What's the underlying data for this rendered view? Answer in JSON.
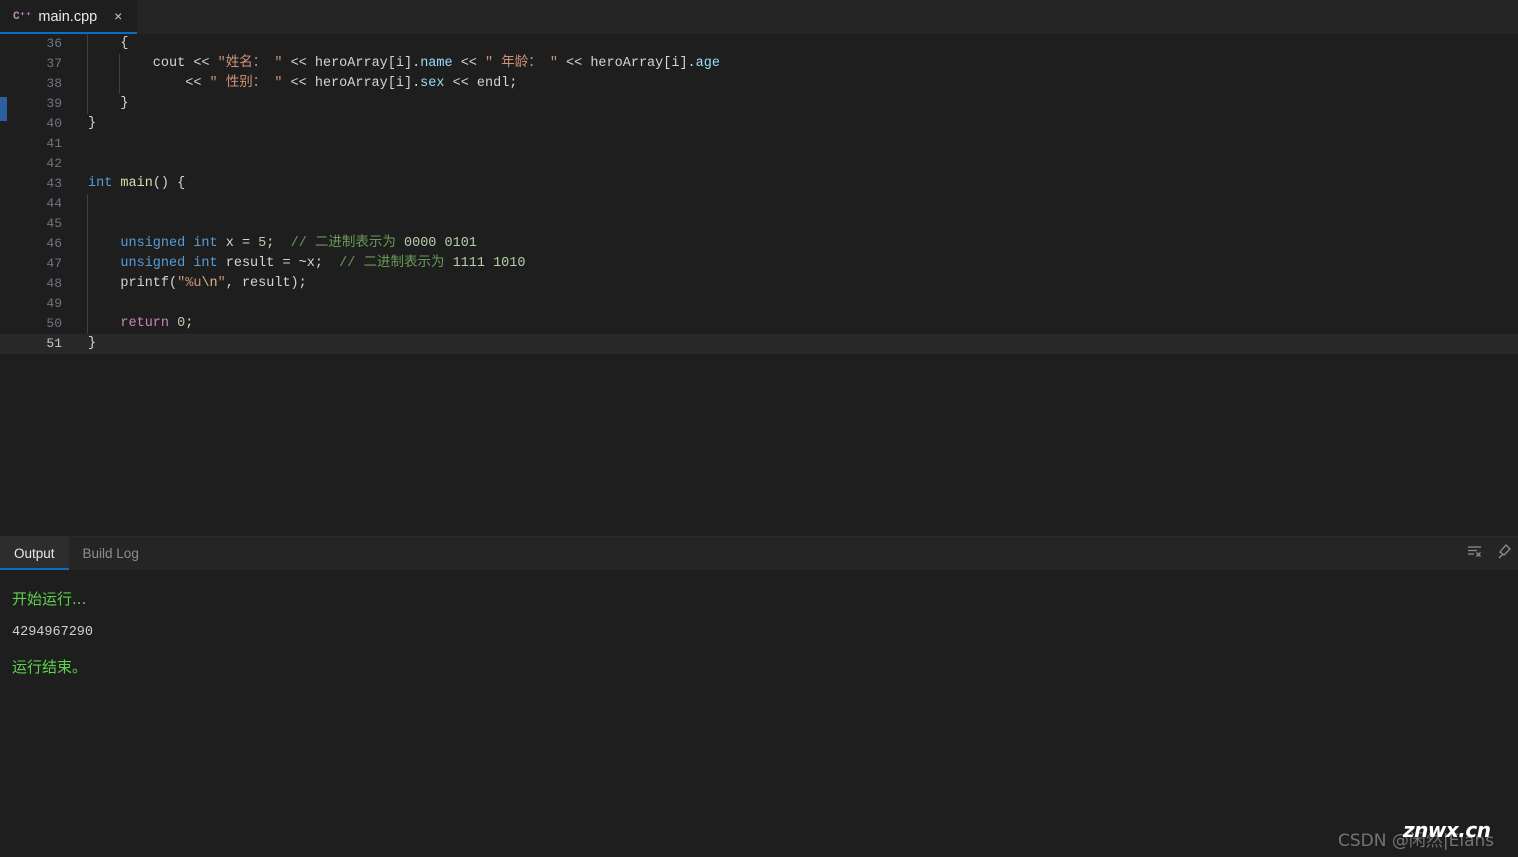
{
  "window": {
    "title": "main.cpp",
    "theme_background": "#1e1e1e",
    "accent_color": "#0a6cc4"
  },
  "tabbar": {
    "tabs": [
      {
        "label": "main.cpp",
        "icon": "cpp-file-icon",
        "icon_glyph": "C⁺⁺",
        "close_glyph": "×",
        "active": true
      }
    ]
  },
  "editor": {
    "language": "cpp",
    "first_visible_line": 36,
    "current_line": 51,
    "lines": [
      {
        "n": "36",
        "indent": 1,
        "tokens": [
          {
            "t": "    ",
            "c": "pl"
          },
          {
            "t": "{",
            "c": "pl"
          }
        ]
      },
      {
        "n": "37",
        "indent": 2,
        "tokens": [
          {
            "t": "        cout ",
            "c": "pl"
          },
          {
            "t": "<<",
            "c": "op"
          },
          {
            "t": " ",
            "c": "pl"
          },
          {
            "t": "\"姓名： \"",
            "c": "str"
          },
          {
            "t": " ",
            "c": "pl"
          },
          {
            "t": "<<",
            "c": "op"
          },
          {
            "t": " heroArray[i].",
            "c": "pl"
          },
          {
            "t": "name",
            "c": "var"
          },
          {
            "t": " ",
            "c": "pl"
          },
          {
            "t": "<<",
            "c": "op"
          },
          {
            "t": " ",
            "c": "pl"
          },
          {
            "t": "\" 年龄： \"",
            "c": "str"
          },
          {
            "t": " ",
            "c": "pl"
          },
          {
            "t": "<<",
            "c": "op"
          },
          {
            "t": " heroArray[i].",
            "c": "pl"
          },
          {
            "t": "age",
            "c": "var"
          }
        ]
      },
      {
        "n": "38",
        "indent": 2,
        "tokens": [
          {
            "t": "            ",
            "c": "pl"
          },
          {
            "t": "<<",
            "c": "op"
          },
          {
            "t": " ",
            "c": "pl"
          },
          {
            "t": "\" 性别： \"",
            "c": "str"
          },
          {
            "t": " ",
            "c": "pl"
          },
          {
            "t": "<<",
            "c": "op"
          },
          {
            "t": " heroArray[i].",
            "c": "pl"
          },
          {
            "t": "sex",
            "c": "var"
          },
          {
            "t": " ",
            "c": "pl"
          },
          {
            "t": "<<",
            "c": "op"
          },
          {
            "t": " endl;",
            "c": "pl"
          }
        ]
      },
      {
        "n": "39",
        "indent": 1,
        "tokens": [
          {
            "t": "    }",
            "c": "pl"
          }
        ]
      },
      {
        "n": "40",
        "indent": 0,
        "tokens": [
          {
            "t": "}",
            "c": "pl"
          }
        ]
      },
      {
        "n": "41",
        "indent": 0,
        "tokens": []
      },
      {
        "n": "42",
        "indent": 0,
        "tokens": []
      },
      {
        "n": "43",
        "indent": 0,
        "tokens": [
          {
            "t": "int",
            "c": "kw"
          },
          {
            "t": " ",
            "c": "pl"
          },
          {
            "t": "main",
            "c": "fn"
          },
          {
            "t": "() {",
            "c": "pl"
          }
        ]
      },
      {
        "n": "44",
        "indent": 1,
        "tokens": []
      },
      {
        "n": "45",
        "indent": 1,
        "tokens": []
      },
      {
        "n": "46",
        "indent": 1,
        "tokens": [
          {
            "t": "    ",
            "c": "pl"
          },
          {
            "t": "unsigned",
            "c": "kw"
          },
          {
            "t": " ",
            "c": "pl"
          },
          {
            "t": "int",
            "c": "kw"
          },
          {
            "t": " x ",
            "c": "pl"
          },
          {
            "t": "=",
            "c": "op"
          },
          {
            "t": " ",
            "c": "pl"
          },
          {
            "t": "5",
            "c": "num"
          },
          {
            "t": ";  ",
            "c": "pl"
          },
          {
            "t": "// 二进制表示为 ",
            "c": "cmt"
          },
          {
            "t": "0000 0101",
            "c": "num"
          }
        ]
      },
      {
        "n": "47",
        "indent": 1,
        "tokens": [
          {
            "t": "    ",
            "c": "pl"
          },
          {
            "t": "unsigned",
            "c": "kw"
          },
          {
            "t": " ",
            "c": "pl"
          },
          {
            "t": "int",
            "c": "kw"
          },
          {
            "t": " result ",
            "c": "pl"
          },
          {
            "t": "=",
            "c": "op"
          },
          {
            "t": " ~x;  ",
            "c": "pl"
          },
          {
            "t": "// 二进制表示为 ",
            "c": "cmt"
          },
          {
            "t": "1111 1010",
            "c": "num"
          }
        ]
      },
      {
        "n": "48",
        "indent": 1,
        "tokens": [
          {
            "t": "    printf(",
            "c": "pl"
          },
          {
            "t": "\"%u",
            "c": "str"
          },
          {
            "t": "\\n",
            "c": "esc"
          },
          {
            "t": "\"",
            "c": "str"
          },
          {
            "t": ", result);",
            "c": "pl"
          }
        ]
      },
      {
        "n": "49",
        "indent": 1,
        "tokens": []
      },
      {
        "n": "50",
        "indent": 1,
        "tokens": [
          {
            "t": "    ",
            "c": "pl"
          },
          {
            "t": "return",
            "c": "kw2"
          },
          {
            "t": " ",
            "c": "pl"
          },
          {
            "t": "0",
            "c": "num"
          },
          {
            "t": ";",
            "c": "pl"
          }
        ]
      },
      {
        "n": "51",
        "indent": 0,
        "current": true,
        "tokens": [
          {
            "t": "}",
            "c": "pl"
          }
        ]
      }
    ]
  },
  "output_panel": {
    "tabs": [
      {
        "label": "Output",
        "active": true
      },
      {
        "label": "Build Log",
        "active": false
      }
    ],
    "actions": [
      {
        "name": "clear-output-icon"
      },
      {
        "name": "pin-panel-icon"
      }
    ],
    "lines": [
      {
        "text": "开始运行...",
        "style": "zh",
        "color": "#5ed14e"
      },
      {
        "text": "4294967290",
        "style": "mono",
        "color": "#d0d0d0"
      },
      {
        "text": "运行结束。",
        "style": "zh",
        "color": "#5ed14e"
      }
    ]
  },
  "watermarks": {
    "csdn": "CSDN @闲然|Elans",
    "site": "znwx.cn"
  }
}
